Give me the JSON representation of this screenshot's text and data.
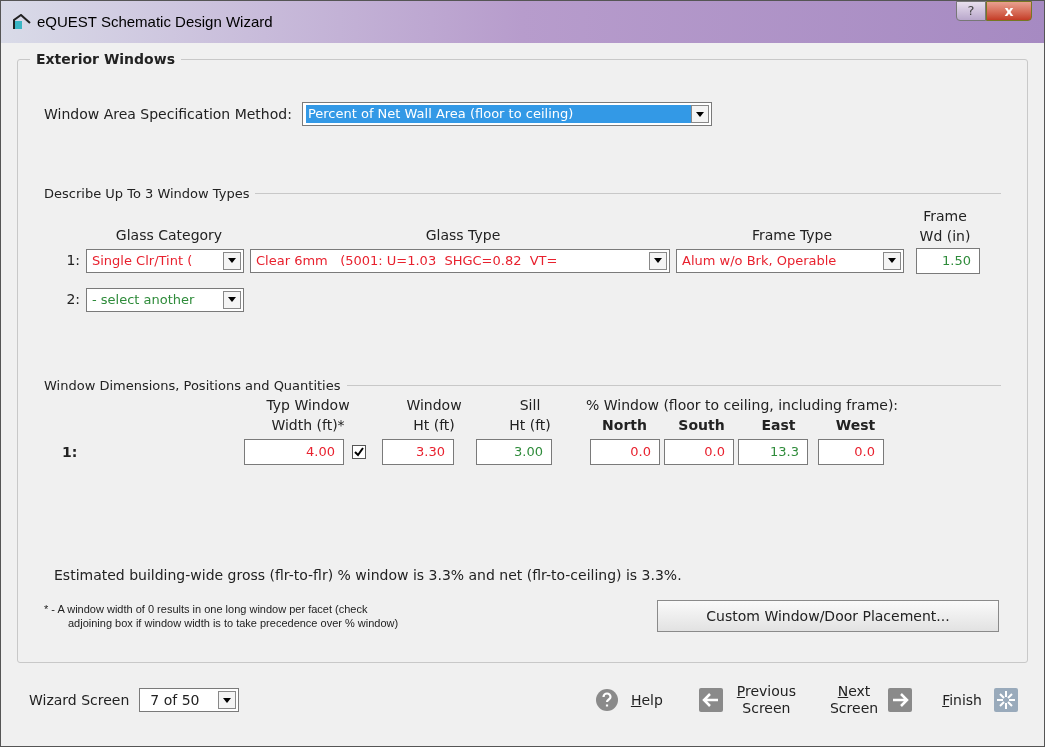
{
  "window": {
    "title": "eQUEST Schematic Design Wizard",
    "buttons": [
      "?",
      "x"
    ]
  },
  "group_title": "Exterior Windows",
  "area_method": {
    "label": "Window Area Specification Method:",
    "value": "Percent of Net Wall Area (floor to ceiling)",
    "selected": true
  },
  "window_types": {
    "title": "Describe Up To 3 Window Types",
    "columns": [
      "Glass Category",
      "Glass Type",
      "Frame Type",
      "Frame\nWd (in)"
    ],
    "rows": [
      {
        "index": "1:",
        "glass_category": {
          "value": "Single Clr/Tint (",
          "color": "#e8212e"
        },
        "glass_type": {
          "value": "Clear 6mm   (5001: U=1.03  SHGC=0.82  VT=",
          "color": "#e8212e"
        },
        "frame_type": {
          "value": "Alum w/o Brk, Operable",
          "color": "#e8212e"
        },
        "frame_width": {
          "value": "1.50",
          "color": "#2e8b3a"
        }
      },
      {
        "index": "2:",
        "glass_category": {
          "value": "- select another",
          "color": "#2e8b3a"
        }
      }
    ]
  },
  "dimensions": {
    "title": "Window Dimensions, Positions and Quantities",
    "headers": {
      "width": "Typ Window\nWidth (ft)*",
      "height": "Window\nHt (ft)",
      "sill": "Sill\nHt (ft)",
      "percent": "% Window (floor to ceiling, including frame):",
      "orientations": [
        "North",
        "South",
        "East",
        "West"
      ]
    },
    "rows": [
      {
        "index": "1:",
        "width": {
          "value": "4.00",
          "color": "#e8212e"
        },
        "width_precedence": {
          "checked": true
        },
        "height": {
          "value": "3.30",
          "color": "#e8212e"
        },
        "sill": {
          "value": "3.00",
          "color": "#2e8b3a"
        },
        "percents": [
          {
            "value": "0.0",
            "color": "#e8212e"
          },
          {
            "value": "0.0",
            "color": "#e8212e"
          },
          {
            "value": "13.3",
            "color": "#2e8b3a"
          },
          {
            "value": "0.0",
            "color": "#e8212e"
          }
        ]
      }
    ]
  },
  "estimate": "Estimated building-wide gross (flr-to-flr) % window is 3.3% and net (flr-to-ceiling) is 3.3%.",
  "footnote": [
    "* - A window width of 0 results in one long window per facet (check",
    "adjoining box if window width is to take precedence over % window)"
  ],
  "custom_button": "Custom Window/Door Placement...",
  "footer": {
    "screen_label": "Wizard Screen",
    "screen_value": "7 of 50",
    "help": "Help",
    "previous": "Previous\nScreen",
    "next": "Next\nScreen",
    "finish": "Finish"
  }
}
